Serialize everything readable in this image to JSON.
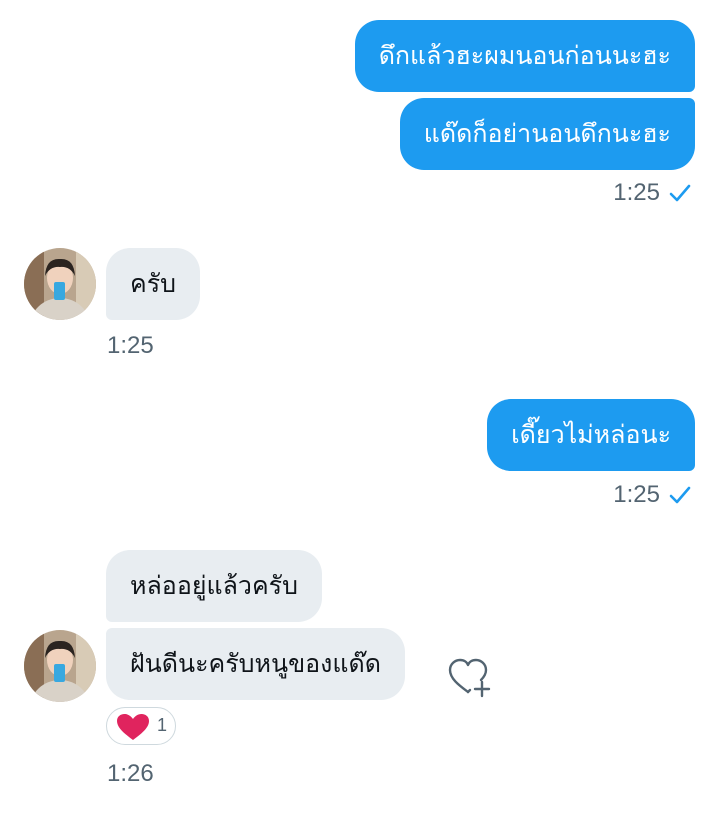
{
  "conversation": {
    "group1": {
      "messages": [
        "ดึกแล้วฮะผมนอนก่อนนะฮะ",
        "แด๊ดก็อย่านอนดึกนะฮะ"
      ],
      "time": "1:25"
    },
    "group2": {
      "messages": [
        "ครับ"
      ],
      "time": "1:25"
    },
    "group3": {
      "messages": [
        "เดี๊ยวไม่หล่อนะ"
      ],
      "time": "1:25"
    },
    "group4": {
      "messages": [
        "หล่ออยู่แล้วครับ",
        "ฝันดีนะครับหนูของแด๊ด"
      ],
      "reaction": {
        "icon": "heart-icon",
        "count": "1"
      },
      "time": "1:26"
    }
  },
  "colors": {
    "outgoing_bubble": "#1d9bf0",
    "incoming_bubble": "#e8edf1",
    "timestamp": "#536471",
    "reaction_heart": "#e0245e"
  }
}
